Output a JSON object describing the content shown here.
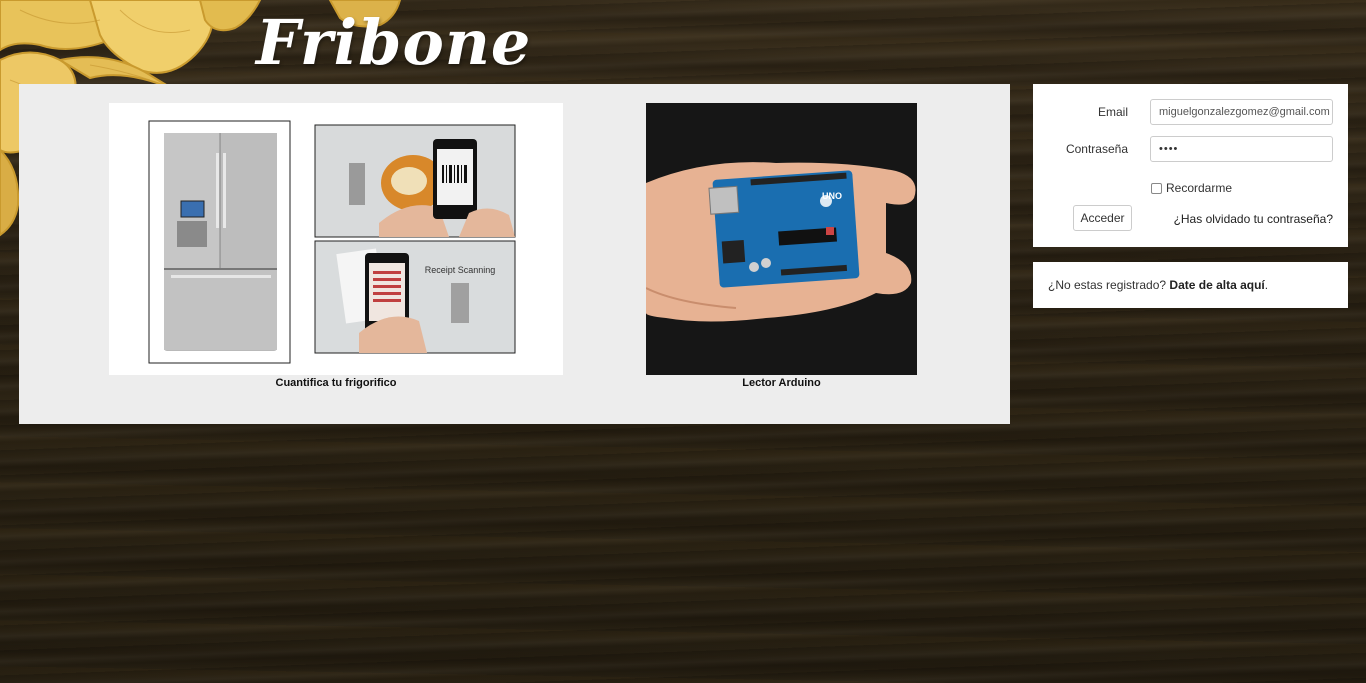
{
  "brand": {
    "logo_text": "Fribone"
  },
  "gallery": {
    "items": [
      {
        "caption": "Cuantifica tu frigorifico",
        "image": "fridge-and-phone-scanning"
      },
      {
        "caption": "Lector Arduino",
        "image": "arduino-uno-in-hand"
      }
    ],
    "scan_text": "Receipt Scanning",
    "board_text": "UNO"
  },
  "login": {
    "email_label": "Email",
    "email_value": "miguelgonzalezgomez@gmail.com",
    "password_label": "Contraseña",
    "password_value": "••••",
    "remember_label": "Recordarme",
    "submit_label": "Acceder",
    "forgot_link": "¿Has olvidado tu contraseña?"
  },
  "register": {
    "prompt": "¿No estas registrado?",
    "link": "Date de alta aquí",
    "suffix": "."
  },
  "colors": {
    "panel_bg": "#ffffff",
    "gallery_bg": "#ededed",
    "wood": "#2e2516"
  }
}
